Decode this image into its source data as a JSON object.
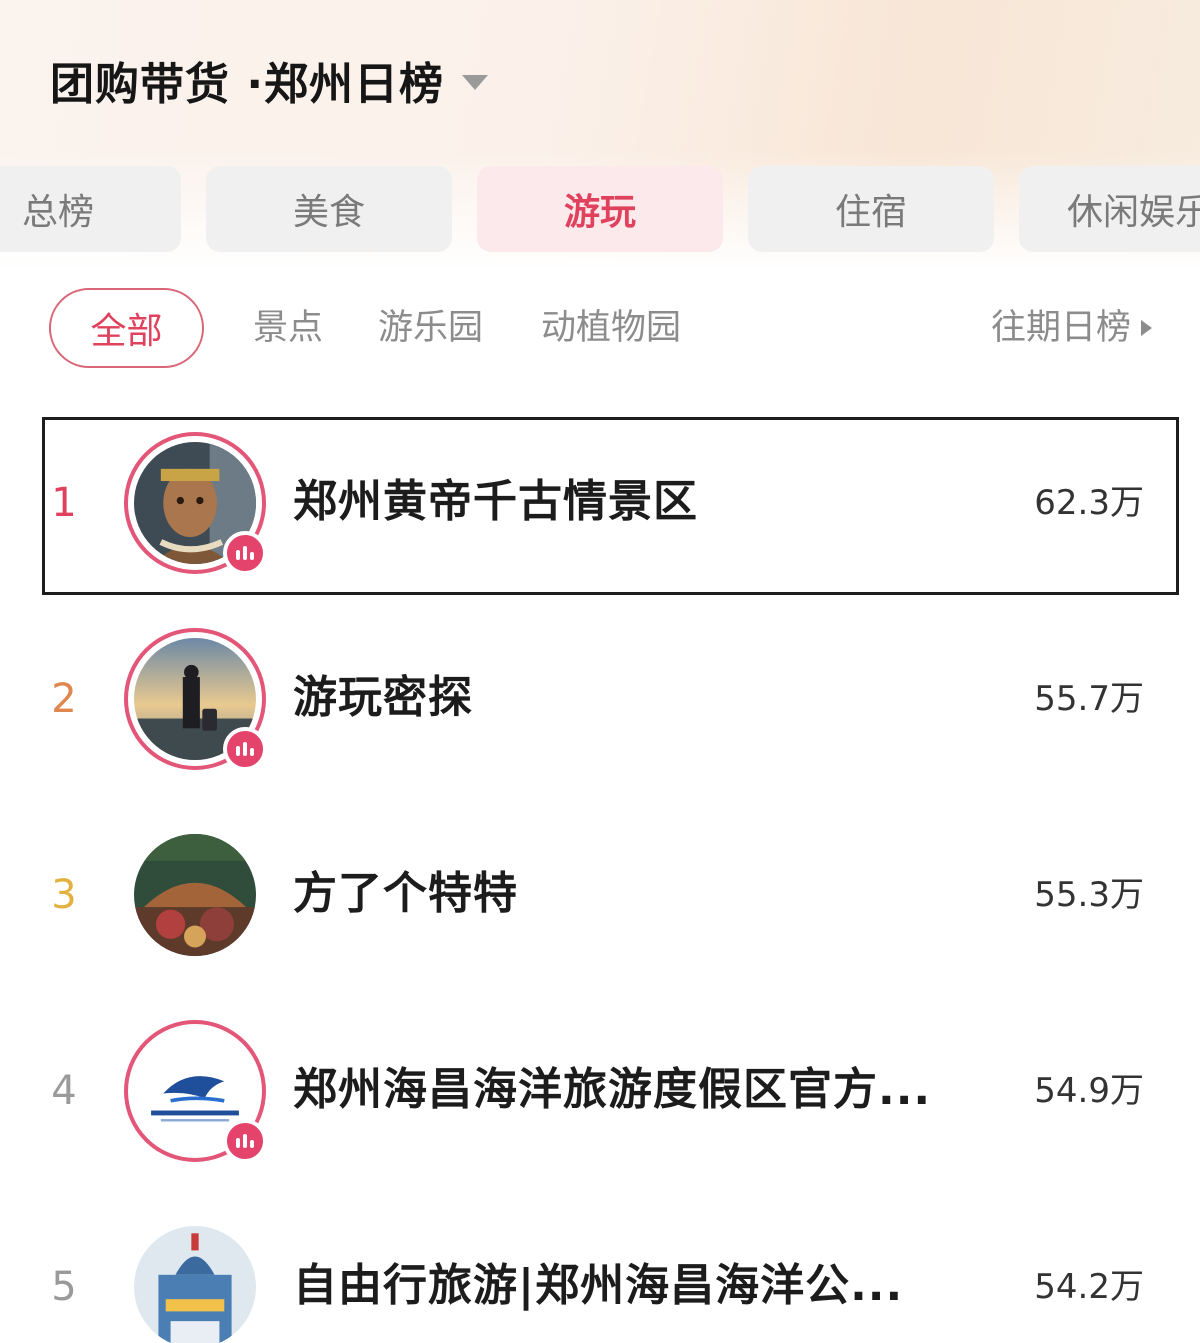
{
  "header": {
    "title": "团购带货 ·郑州日榜"
  },
  "category_tabs": [
    {
      "label": "总榜",
      "active": false
    },
    {
      "label": "美食",
      "active": false
    },
    {
      "label": "游玩",
      "active": true
    },
    {
      "label": "住宿",
      "active": false
    },
    {
      "label": "休闲娱乐",
      "active": false
    }
  ],
  "sub_tabs": {
    "selected": "全部",
    "items": [
      "景点",
      "游乐园",
      "动植物园"
    ],
    "history": "往期日榜"
  },
  "ranking": [
    {
      "rank": "1",
      "name": "郑州黄帝千古情景区",
      "score": "62.3万",
      "live": true,
      "highlighted": true
    },
    {
      "rank": "2",
      "name": "游玩密探",
      "score": "55.7万",
      "live": true,
      "highlighted": false
    },
    {
      "rank": "3",
      "name": "方了个特特",
      "score": "55.3万",
      "live": false,
      "highlighted": false
    },
    {
      "rank": "4",
      "name": "郑州海昌海洋旅游度假区官方...",
      "score": "54.9万",
      "live": true,
      "highlighted": false
    },
    {
      "rank": "5",
      "name": "自由行旅游|郑州海昌海洋公...",
      "score": "54.2万",
      "live": false,
      "highlighted": false
    }
  ],
  "colors": {
    "accent": "#e0415c",
    "rank1": "#e0415c",
    "rank2": "#e0874f",
    "rank3": "#e3b13f",
    "rank_other": "#9a9a9a",
    "live_ring": "#e35678"
  }
}
